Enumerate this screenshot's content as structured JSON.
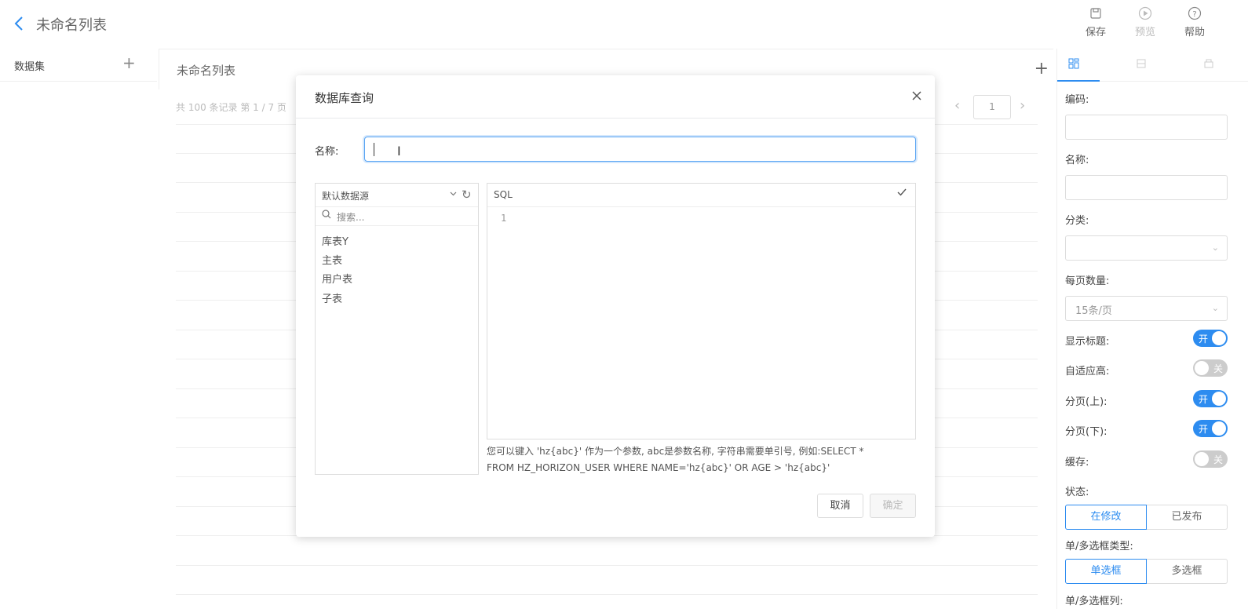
{
  "header": {
    "back_icon": "chevron-left-icon",
    "title": "未命名列表",
    "tools": [
      {
        "label": "保存",
        "icon": "save-icon"
      },
      {
        "label": "预览",
        "icon": "play-circle-icon"
      },
      {
        "label": "帮助",
        "icon": "help-circle-icon"
      }
    ]
  },
  "sidebar": {
    "title": "数据集",
    "add_icon": "plus-icon"
  },
  "main": {
    "tab_title": "未命名列表",
    "records_text": "共 100 条记录  第 1 / 7 页",
    "page_number": "1"
  },
  "properties": {
    "code_label": "编码:",
    "name_label": "名称:",
    "category_label": "分类:",
    "page_size_label": "每页数量:",
    "page_size_value": "15条/页",
    "switches": [
      {
        "label": "显示标题:",
        "on": true,
        "text": "开"
      },
      {
        "label": "自适应高:",
        "on": false,
        "text": "关"
      },
      {
        "label": "分页(上):",
        "on": true,
        "text": "开"
      },
      {
        "label": "分页(下):",
        "on": true,
        "text": "开"
      },
      {
        "label": "缓存:",
        "on": false,
        "text": "关"
      }
    ],
    "status_label": "状态:",
    "status_options": [
      "在修改",
      "已发布"
    ],
    "selector_type_label": "单/多选框类型:",
    "selector_type_options": [
      "单选框",
      "多选框"
    ],
    "selector_column_label": "单/多选框列:"
  },
  "modal": {
    "title": "数据库查询",
    "name_label": "名称:",
    "name_value": "",
    "datasource": "默认数据源",
    "search_placeholder": "搜索...",
    "tables": [
      "库表Y",
      "主表",
      "用户表",
      "子表"
    ],
    "sql_label": "SQL",
    "line_number": "1",
    "hint_line1": "您可以键入 'hz{abc}' 作为一个参数, abc是参数名称, 字符串需要单引号, 例如:SELECT *",
    "hint_line2": "FROM HZ_HORIZON_USER WHERE NAME='hz{abc}' OR AGE > 'hz{abc}'",
    "cancel_label": "取消",
    "ok_label": "确定"
  },
  "colors": {
    "accent": "#2d8cf0",
    "switch_off": "#cccccc"
  }
}
